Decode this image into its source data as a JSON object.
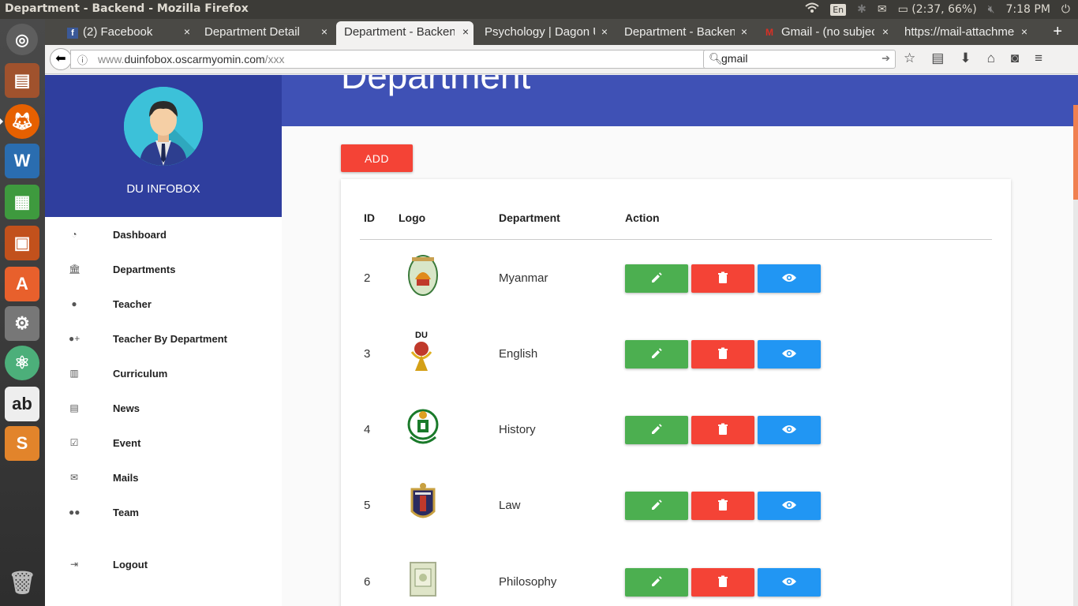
{
  "os": {
    "window_title": "Department - Backend - Mozilla Firefox",
    "lang": "En",
    "battery": "(2:37, 66%)",
    "time": "7:18 PM"
  },
  "browser": {
    "tabs": [
      {
        "label": "(2) Facebook",
        "icon": "facebook-icon"
      },
      {
        "label": "Department Detail",
        "icon": ""
      },
      {
        "label": "Department - Backend",
        "icon": "",
        "active": true
      },
      {
        "label": "Psychology | Dagon U",
        "icon": ""
      },
      {
        "label": "Department - Backend",
        "icon": ""
      },
      {
        "label": "Gmail - (no subject)",
        "icon": "gmail-icon"
      },
      {
        "label": "https://mail-attachme",
        "icon": ""
      }
    ],
    "url_prefix": "www.",
    "url_host": "duinfobox.oscarmyomin.com",
    "url_path": "/xxx",
    "search_value": "gmail"
  },
  "sidebar": {
    "brand": "DU INFOBOX",
    "items": [
      {
        "label": "Dashboard",
        "icon": "dashboard-icon"
      },
      {
        "label": "Departments",
        "icon": "bank-icon"
      },
      {
        "label": "Teacher",
        "icon": "user-icon"
      },
      {
        "label": "Teacher By Department",
        "icon": "user-plus-icon"
      },
      {
        "label": "Curriculum",
        "icon": "book-icon"
      },
      {
        "label": "News",
        "icon": "newspaper-icon"
      },
      {
        "label": "Event",
        "icon": "calendar-icon"
      },
      {
        "label": "Mails",
        "icon": "envelope-icon"
      },
      {
        "label": "Team",
        "icon": "users-icon"
      },
      {
        "label": "Logout",
        "icon": "sign-out-icon"
      }
    ]
  },
  "header": {
    "title": "Department"
  },
  "main": {
    "add_label": "ADD",
    "columns": [
      "ID",
      "Logo",
      "Department",
      "Action"
    ],
    "rows": [
      {
        "id": "2",
        "department": "Myanmar",
        "logo_text": ""
      },
      {
        "id": "3",
        "department": "English",
        "logo_text": "DU"
      },
      {
        "id": "4",
        "department": "History",
        "logo_text": ""
      },
      {
        "id": "5",
        "department": "Law",
        "logo_text": ""
      },
      {
        "id": "6",
        "department": "Philosophy",
        "logo_text": ""
      }
    ]
  },
  "colors": {
    "header": "#3f51b5",
    "sidebar_profile": "#2f3e9e",
    "add": "#f44336",
    "edit": "#4caf50",
    "delete": "#f44336",
    "view": "#2196f3"
  }
}
